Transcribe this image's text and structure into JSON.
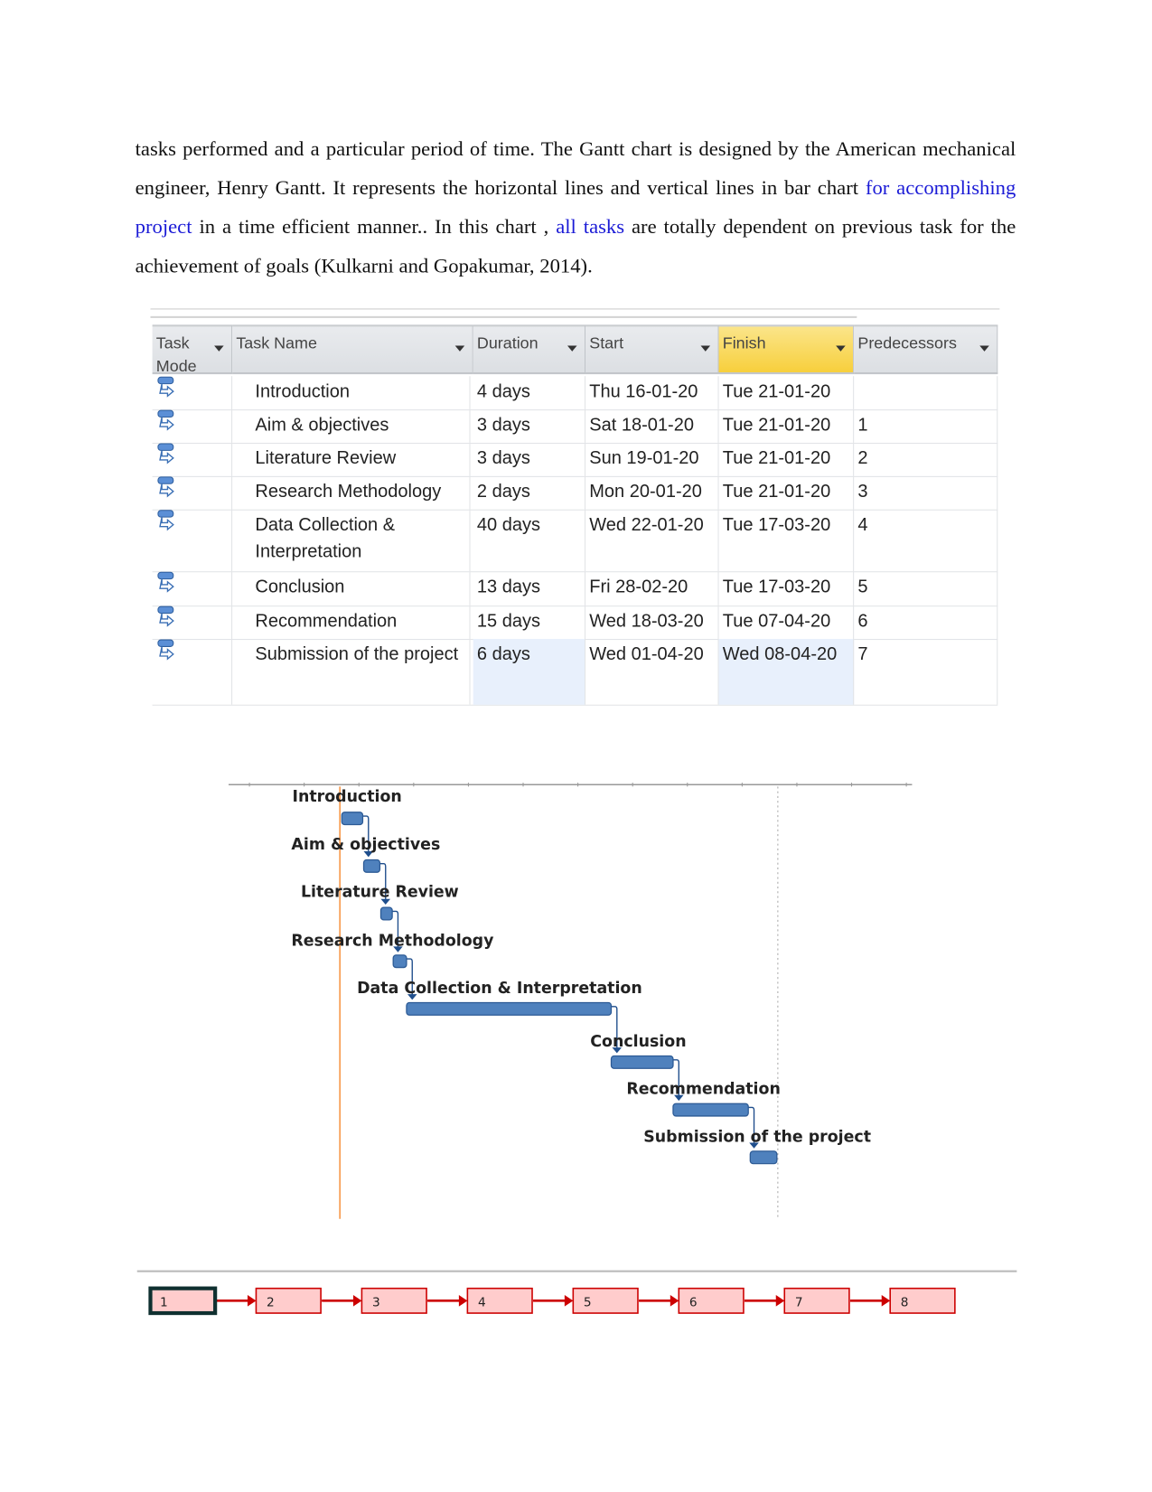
{
  "paragraph": {
    "segments": [
      {
        "text": "tasks performed and a particular period of time. The Gantt chart is designed by the American mechanical engineer, Henry Gantt. It represents the horizontal lines and vertical lines in bar chart ",
        "link": false
      },
      {
        "text": "for accomplishing project",
        "link": true
      },
      {
        "text": " in a time efficient manner.. In this chart , ",
        "link": false
      },
      {
        "text": "all tasks",
        "link": true
      },
      {
        "text": " are totally dependent on previous task for the achievement of goals (Kulkarni and Gopakumar, 2014).",
        "link": false
      }
    ]
  },
  "table": {
    "headers": [
      "Task Mode",
      "Task Name",
      "Duration",
      "Start",
      "Finish",
      "Predecessors"
    ],
    "rows": [
      {
        "mode": "auto-scheduled-icon",
        "name": "Introduction",
        "duration": "4 days",
        "start": "Thu 16-01-20",
        "finish": "Tue 21-01-20",
        "pred": ""
      },
      {
        "mode": "auto-scheduled-icon",
        "name": "Aim & objectives",
        "duration": "3 days",
        "start": "Sat 18-01-20",
        "finish": "Tue 21-01-20",
        "pred": "1"
      },
      {
        "mode": "auto-scheduled-icon",
        "name": "Literature Review",
        "duration": "3 days",
        "start": "Sun 19-01-20",
        "finish": "Tue 21-01-20",
        "pred": "2"
      },
      {
        "mode": "auto-scheduled-icon",
        "name": "Research Methodology",
        "duration": "2 days",
        "start": "Mon 20-01-20",
        "finish": "Tue 21-01-20",
        "pred": "3"
      },
      {
        "mode": "auto-scheduled-icon",
        "name": "Data Collection & Interpretation",
        "duration": "40 days",
        "start": "Wed 22-01-20",
        "finish": "Tue 17-03-20",
        "pred": "4"
      },
      {
        "mode": "auto-scheduled-icon",
        "name": "Conclusion",
        "duration": "13 days",
        "start": "Fri 28-02-20",
        "finish": "Tue 17-03-20",
        "pred": "5"
      },
      {
        "mode": "auto-scheduled-icon",
        "name": "Recommendation",
        "duration": "15 days",
        "start": "Wed 18-03-20",
        "finish": "Tue 07-04-20",
        "pred": "6"
      },
      {
        "mode": "auto-scheduled-icon",
        "name": "Submission of the project",
        "duration": "6 days",
        "start": "Wed 01-04-20",
        "finish": "Wed 08-04-20",
        "pred": "7"
      }
    ]
  },
  "gantt": {
    "labels": [
      "Introduction",
      "Aim & objectives",
      "Literature Review",
      "Research Methodology",
      "Data Collection & Interpretation",
      "Conclusion",
      "Recommendation",
      "Submission of the project"
    ],
    "colors": {
      "bar": "#4f81bd",
      "today_line": "#f79646",
      "link": "#1f4e8c"
    }
  },
  "network": {
    "nodes": [
      "1",
      "2",
      "3",
      "4",
      "5",
      "6",
      "7",
      "8"
    ],
    "colors": {
      "box_fill": "#ffcccc",
      "border": "#cc0000",
      "selected": "#0f3030"
    }
  }
}
